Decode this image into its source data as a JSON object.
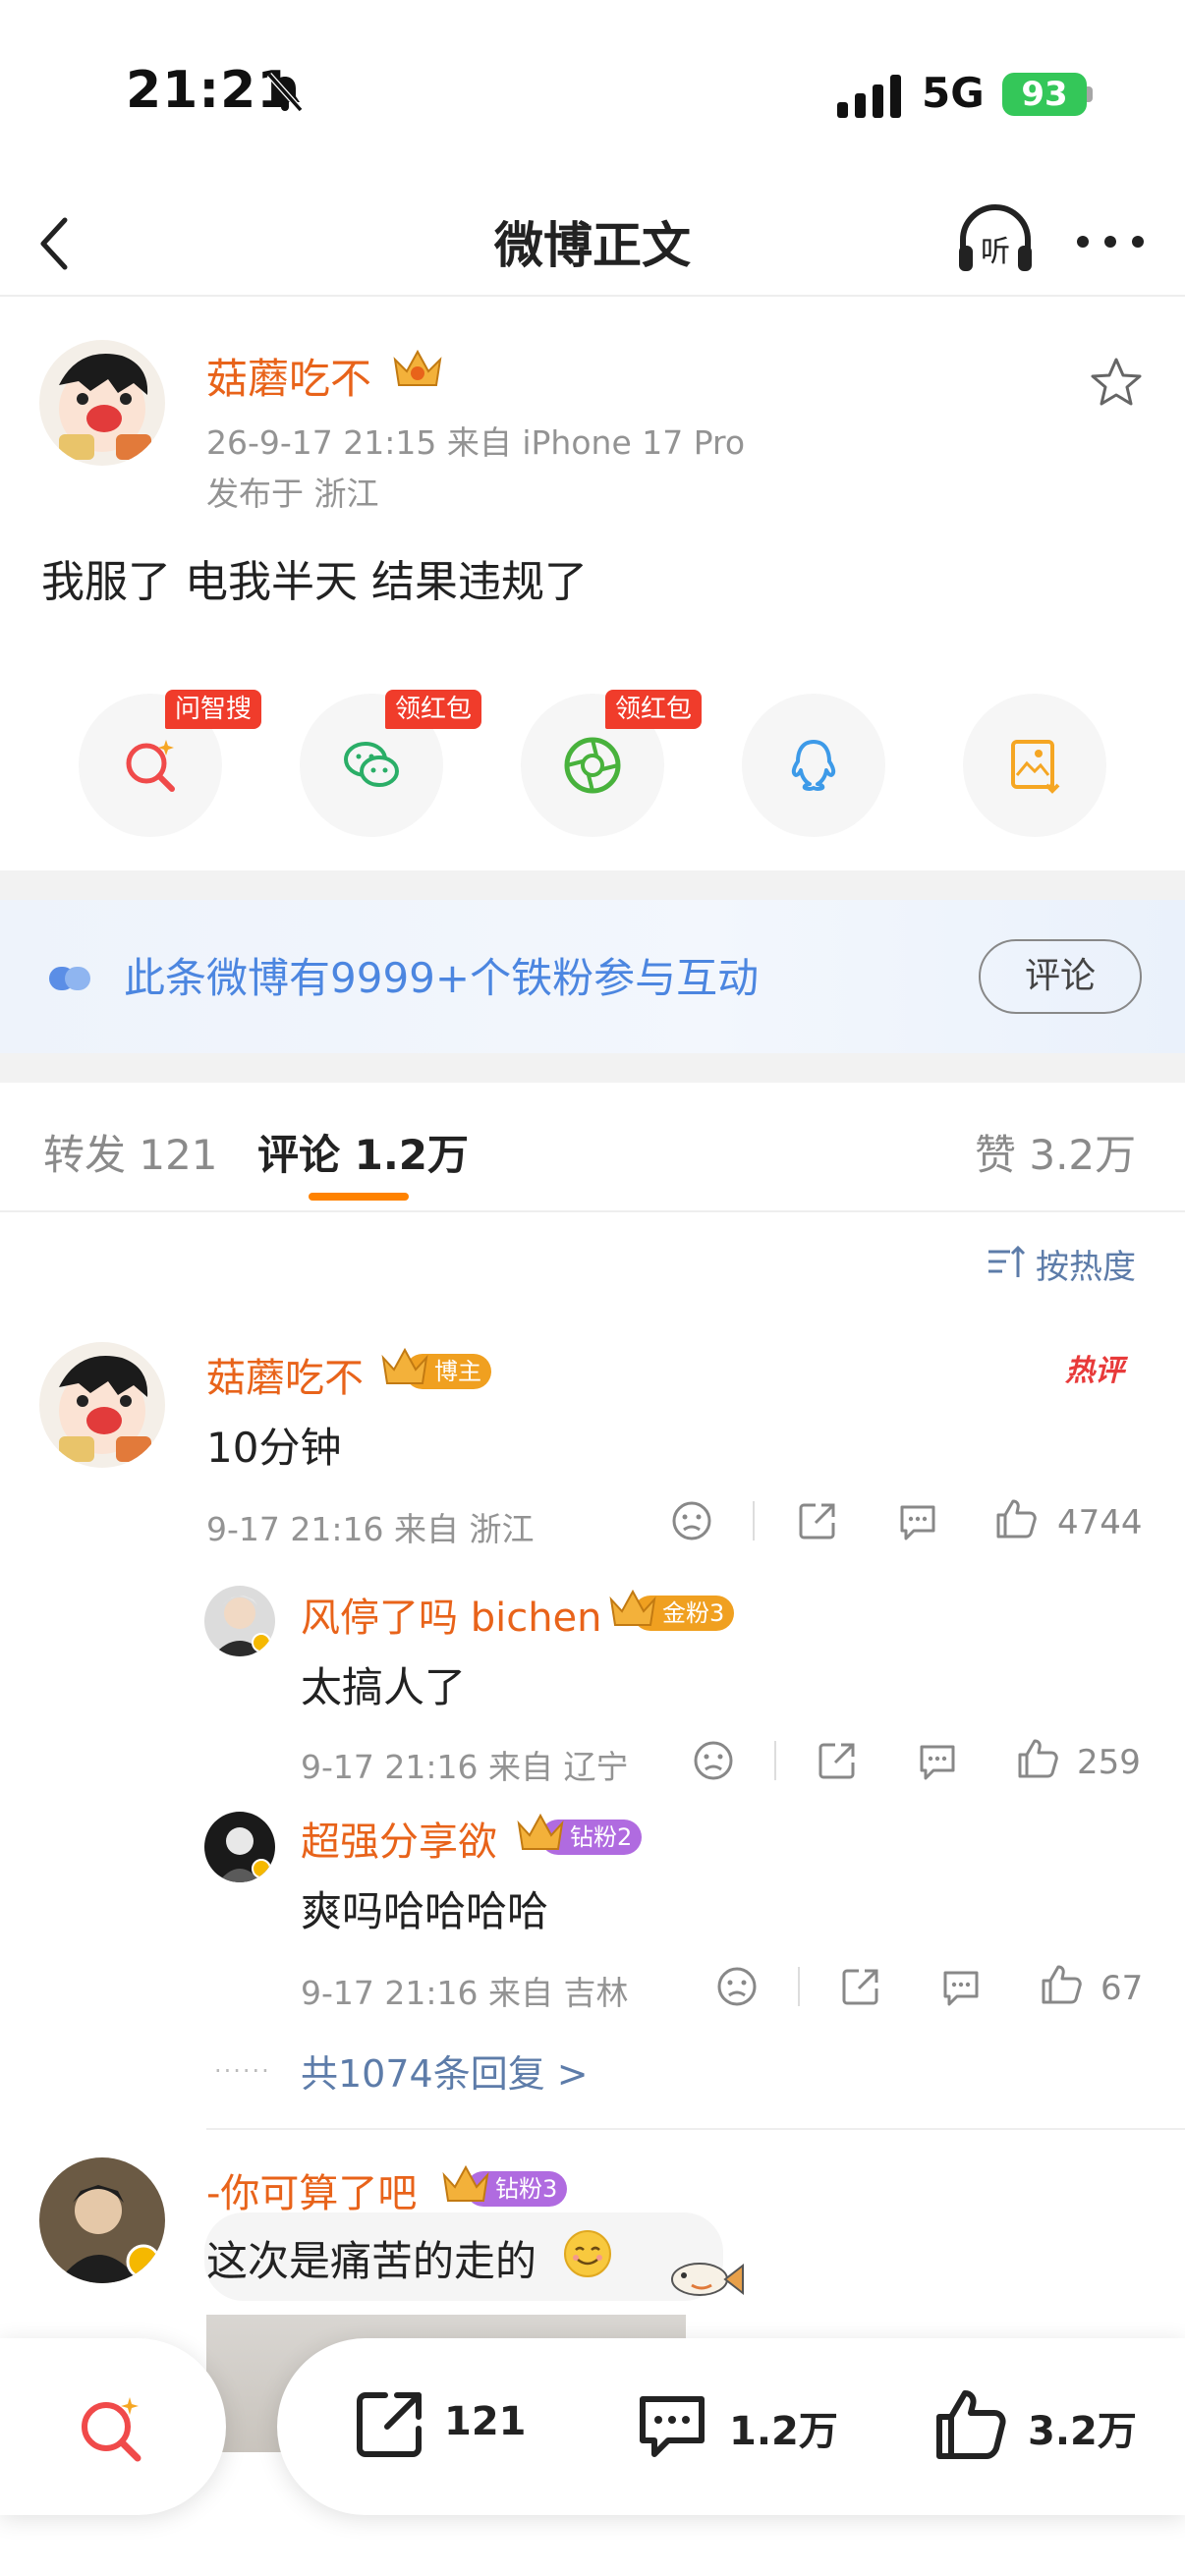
{
  "status": {
    "time": "21:21",
    "network": "5G",
    "battery": "93"
  },
  "nav": {
    "title": "微博正文",
    "listen_label": "听"
  },
  "post": {
    "author": "菇蘑吃不",
    "timestamp_source": "26-9-17 21:15  来自 iPhone 17 Pro",
    "location": "发布于 浙江",
    "text": "我服了 电我半天 结果违规了"
  },
  "share": {
    "items": [
      {
        "icon": "ai-search-icon",
        "tag": "问智搜"
      },
      {
        "icon": "wechat-icon",
        "tag": "领红包"
      },
      {
        "icon": "moments-icon",
        "tag": "领红包"
      },
      {
        "icon": "qq-icon",
        "tag": ""
      },
      {
        "icon": "save-image-icon",
        "tag": ""
      }
    ]
  },
  "banner": {
    "text": "此条微博有9999+个铁粉参与互动",
    "button": "评论"
  },
  "tabs": {
    "repost": "转发 121",
    "comment": "评论 1.2万",
    "like": "赞 3.2万"
  },
  "sort_label": "按热度",
  "comments": [
    {
      "name": "菇蘑吃不",
      "badge": "博主",
      "hot_label": "热评",
      "text": "10分钟",
      "meta": "9-17 21:16  来自 浙江",
      "likes": "4744"
    },
    {
      "name": "风停了吗 bichen",
      "badge": "金粉3",
      "text": "太搞人了",
      "meta": "9-17 21:16  来自 辽宁",
      "likes": "259"
    },
    {
      "name": "超强分享欲",
      "badge": "钻粉2",
      "text": "爽吗哈哈哈哈",
      "meta": "9-17 21:16  来自 吉林",
      "likes": "67"
    },
    {
      "name": "-你可算了吧",
      "badge": "钻粉3",
      "text": "这次是痛苦的走的"
    }
  ],
  "more_replies": "共1074条回复 >",
  "bottom": {
    "reposts": "121",
    "comments": "1.2万",
    "likes": "3.2万"
  },
  "colors": {
    "accent": "#ff8200",
    "name": "#e8631a",
    "link": "#5d7ca9",
    "gold": "#f0a020",
    "purple": "#b06be0"
  }
}
